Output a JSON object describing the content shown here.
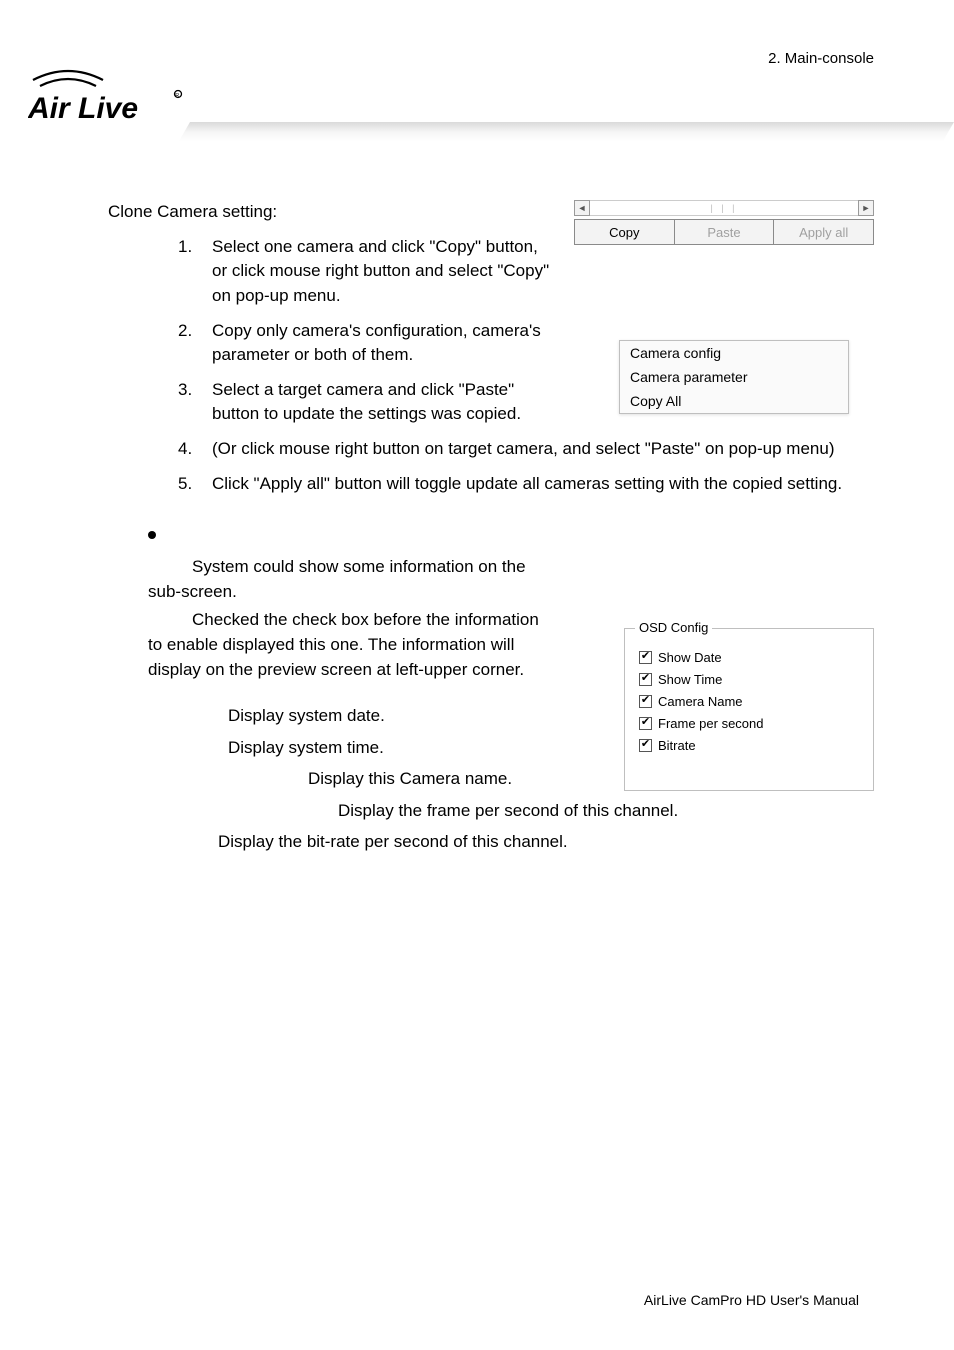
{
  "header": {
    "breadcrumb": "2. Main-console",
    "logo_text": "Air Live"
  },
  "clone": {
    "heading": "Clone Camera setting:",
    "steps": [
      "Select one camera and click \"Copy\" button, or click mouse right button and select \"Copy\" on pop-up menu.",
      "Copy only camera's configuration, camera's parameter or both of them.",
      "Select a target camera and click \"Paste\" button to update the settings was copied.",
      "(Or click mouse right button on target camera, and select \"Paste\" on pop-up menu)",
      "Click \"Apply all\" button will toggle update all cameras setting with the copied setting."
    ]
  },
  "copybar": {
    "copy": "Copy",
    "paste": "Paste",
    "apply_all": "Apply all"
  },
  "context_menu": {
    "items": [
      "Camera config",
      "Camera parameter",
      "Copy All"
    ]
  },
  "osd_section": {
    "para1_line1": "System could show some information on the",
    "para1_line2": "sub-screen.",
    "para2_line1": "Checked the check box before the information",
    "para2_line2": "to enable displayed this one. The information will",
    "para2_line3": "display on the preview screen at left-upper corner.",
    "show_date": "Display system date.",
    "show_time": "Display system time.",
    "camera_name": "Display this Camera name.",
    "frame_per_second": "Display the frame per second of this channel.",
    "bitrate": "Display the bit-rate per second of this channel."
  },
  "osd_box": {
    "title": "OSD Config",
    "items": [
      "Show Date",
      "Show Time",
      "Camera Name",
      "Frame per second",
      "Bitrate"
    ]
  },
  "footer": "AirLive CamPro HD User's Manual"
}
